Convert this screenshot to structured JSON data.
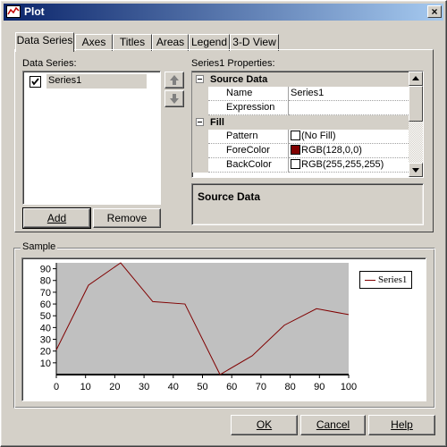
{
  "window": {
    "title": "Plot",
    "close_glyph": "×"
  },
  "tabs": [
    "Data Series",
    "Axes",
    "Titles",
    "Areas",
    "Legend",
    "3-D View"
  ],
  "data_series": {
    "label": "Data Series:",
    "items": [
      {
        "label": "Series1",
        "checked": true
      }
    ],
    "add_label": "Add",
    "remove_label": "Remove"
  },
  "properties": {
    "label": "Series1 Properties:",
    "categories": [
      {
        "name": "Source Data",
        "rows": [
          {
            "name": "Name",
            "value": "Series1"
          },
          {
            "name": "Expression",
            "value": ""
          }
        ]
      },
      {
        "name": "Fill",
        "rows": [
          {
            "name": "Pattern",
            "value": "(No Fill)",
            "swatch": "#ffffff"
          },
          {
            "name": "ForeColor",
            "value": "RGB(128,0,0)",
            "swatch": "#800000"
          },
          {
            "name": "BackColor",
            "value": "RGB(255,255,255)",
            "swatch": "#ffffff"
          }
        ]
      }
    ],
    "description_title": "Source Data"
  },
  "sample": {
    "label": "Sample"
  },
  "chart_data": {
    "type": "line",
    "x": [
      0,
      11,
      22,
      33,
      44,
      56,
      67,
      78,
      89,
      100
    ],
    "series": [
      {
        "name": "Series1",
        "color": "#800000",
        "values": [
          21,
          76,
          95,
          62,
          60,
          0,
          16,
          42,
          56,
          51
        ]
      }
    ],
    "xlim": [
      0,
      100
    ],
    "ylim": [
      0,
      95
    ],
    "x_ticks": [
      0,
      10,
      20,
      30,
      40,
      50,
      60,
      70,
      80,
      90,
      100
    ],
    "y_ticks": [
      10,
      20,
      30,
      40,
      50,
      60,
      70,
      80,
      90
    ],
    "plot_background": "#c0c0c0",
    "legend_position": "right",
    "grid": false
  },
  "buttons": {
    "ok": "OK",
    "cancel": "Cancel",
    "help": "Help"
  }
}
